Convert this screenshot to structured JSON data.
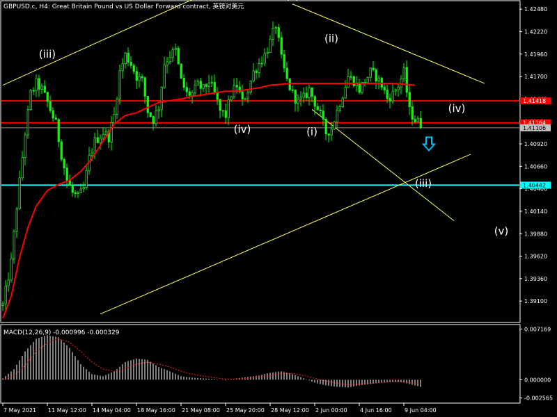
{
  "chart_title": "GBPUSD.c, H4:  Great Britain Pound vs US Dollar Forward contract, 英镑对美元",
  "macd_label": "MACD(12,26,9) -0.000996 -0.000329",
  "colors": {
    "background": "#000000",
    "candle": "#00ff00",
    "ma_line": "#ff0000",
    "trend_line": "#ffff66",
    "level_red": "#ff0000",
    "level_cyan": "#00ffff",
    "arrow": "#00bfff",
    "macd_hist": "#ffffff",
    "macd_signal": "#ff2020"
  },
  "chart_data": {
    "type": "candlestick",
    "symbol": "GBPUSD.c",
    "timeframe": "H4",
    "ylim": [
      1.3886,
      1.4257
    ],
    "y_ticks": [
      "1.42480",
      "1.42220",
      "1.41960",
      "1.41700",
      "1.41440",
      "1.41180",
      "1.40920",
      "1.40660",
      "1.40400",
      "1.40140",
      "1.39880",
      "1.39620",
      "1.39360",
      "1.39100"
    ],
    "x_ticks": [
      {
        "label": "7 May 2021",
        "bar": 0
      },
      {
        "label": "11 May 12:00",
        "bar": 16
      },
      {
        "label": "14 May 04:00",
        "bar": 32
      },
      {
        "label": "18 May 16:00",
        "bar": 48
      },
      {
        "label": "21 May 08:00",
        "bar": 64
      },
      {
        "label": "25 May 20:00",
        "bar": 80
      },
      {
        "label": "28 May 12:00",
        "bar": 96
      },
      {
        "label": "2 Jun 00:00",
        "bar": 112
      },
      {
        "label": "4 Jun 16:00",
        "bar": 128
      },
      {
        "label": "9 Jun 04:00",
        "bar": 144
      }
    ],
    "close_path": [
      [
        0,
        1.3905
      ],
      [
        3,
        1.3955
      ],
      [
        5,
        1.402
      ],
      [
        8,
        1.4105
      ],
      [
        10,
        1.415
      ],
      [
        12,
        1.4162
      ],
      [
        14,
        1.4155
      ],
      [
        16,
        1.414
      ],
      [
        19,
        1.4115
      ],
      [
        21,
        1.408
      ],
      [
        23,
        1.405
      ],
      [
        25,
        1.4035
      ],
      [
        27,
        1.403
      ],
      [
        29,
        1.404
      ],
      [
        31,
        1.4075
      ],
      [
        33,
        1.4095
      ],
      [
        36,
        1.4105
      ],
      [
        38,
        1.41
      ],
      [
        40,
        1.4125
      ],
      [
        42,
        1.4175
      ],
      [
        44,
        1.4195
      ],
      [
        46,
        1.4185
      ],
      [
        48,
        1.417
      ],
      [
        50,
        1.4165
      ],
      [
        52,
        1.413
      ],
      [
        54,
        1.412
      ],
      [
        56,
        1.4135
      ],
      [
        58,
        1.4185
      ],
      [
        60,
        1.4195
      ],
      [
        62,
        1.42
      ],
      [
        64,
        1.4165
      ],
      [
        66,
        1.415
      ],
      [
        68,
        1.415
      ],
      [
        70,
        1.416
      ],
      [
        72,
        1.4155
      ],
      [
        74,
        1.4165
      ],
      [
        76,
        1.415
      ],
      [
        78,
        1.413
      ],
      [
        80,
        1.4125
      ],
      [
        82,
        1.415
      ],
      [
        84,
        1.416
      ],
      [
        86,
        1.414
      ],
      [
        88,
        1.4155
      ],
      [
        90,
        1.4175
      ],
      [
        92,
        1.4185
      ],
      [
        94,
        1.4195
      ],
      [
        96,
        1.421
      ],
      [
        98,
        1.423
      ],
      [
        100,
        1.419
      ],
      [
        102,
        1.4165
      ],
      [
        104,
        1.415
      ],
      [
        106,
        1.414
      ],
      [
        108,
        1.4145
      ],
      [
        110,
        1.4155
      ],
      [
        112,
        1.414
      ],
      [
        114,
        1.4125
      ],
      [
        116,
        1.4105
      ],
      [
        118,
        1.411
      ],
      [
        120,
        1.413
      ],
      [
        122,
        1.415
      ],
      [
        124,
        1.417
      ],
      [
        126,
        1.4165
      ],
      [
        128,
        1.4155
      ],
      [
        130,
        1.4165
      ],
      [
        132,
        1.4175
      ],
      [
        134,
        1.417
      ],
      [
        136,
        1.416
      ],
      [
        138,
        1.4145
      ],
      [
        140,
        1.415
      ],
      [
        142,
        1.416
      ],
      [
        144,
        1.4175
      ],
      [
        146,
        1.413
      ],
      [
        148,
        1.412
      ],
      [
        150,
        1.4115
      ]
    ],
    "ma_path": [
      [
        0,
        1.389
      ],
      [
        3,
        1.3915
      ],
      [
        6,
        1.396
      ],
      [
        9,
        1.3995
      ],
      [
        12,
        1.402
      ],
      [
        16,
        1.4038
      ],
      [
        20,
        1.4045
      ],
      [
        24,
        1.405
      ],
      [
        28,
        1.406
      ],
      [
        32,
        1.4075
      ],
      [
        36,
        1.4095
      ],
      [
        40,
        1.4115
      ],
      [
        44,
        1.4125
      ],
      [
        48,
        1.4128
      ],
      [
        52,
        1.4134
      ],
      [
        56,
        1.414
      ],
      [
        60,
        1.4142
      ],
      [
        64,
        1.4144
      ],
      [
        68,
        1.4147
      ],
      [
        72,
        1.4149
      ],
      [
        76,
        1.4151
      ],
      [
        80,
        1.4153
      ],
      [
        84,
        1.4153
      ],
      [
        88,
        1.4155
      ],
      [
        92,
        1.4157
      ],
      [
        96,
        1.416
      ],
      [
        100,
        1.4161
      ],
      [
        104,
        1.4162
      ],
      [
        108,
        1.4162
      ],
      [
        112,
        1.4162
      ],
      [
        116,
        1.4162
      ],
      [
        120,
        1.4162
      ],
      [
        124,
        1.4162
      ],
      [
        128,
        1.4162
      ],
      [
        132,
        1.4162
      ],
      [
        136,
        1.4162
      ],
      [
        140,
        1.4162
      ],
      [
        144,
        1.4161
      ],
      [
        148,
        1.416
      ]
    ],
    "level_lines": [
      {
        "price": 1.41418,
        "label": "1.41418",
        "color": "#ff0000"
      },
      {
        "price": 1.41164,
        "label": "1.41164",
        "color": "#ff0000"
      },
      {
        "price": 1.41106,
        "label": "1.41106",
        "color": "#8c8c8c"
      },
      {
        "price": 1.40442,
        "label": "1.40442",
        "color": "#00ffff"
      }
    ],
    "trend_lines": [
      {
        "from": [
          0,
          1.416
        ],
        "to": [
          70,
          1.4262
        ]
      },
      {
        "from": [
          104,
          1.4254
        ],
        "to": [
          173,
          1.4162
        ]
      },
      {
        "from": [
          111,
          1.4132
        ],
        "to": [
          162,
          1.4003
        ]
      },
      {
        "from": [
          35,
          1.3895
        ],
        "to": [
          168,
          1.408
        ]
      }
    ],
    "wave_labels": [
      {
        "text": "(iii)",
        "bar": 16,
        "price": 1.4192
      },
      {
        "text": "(iv)",
        "bar": 86,
        "price": 1.4105
      },
      {
        "text": "(v)",
        "bar": 104,
        "price": 1.426
      },
      {
        "text": "(i)",
        "bar": 111,
        "price": 1.4102
      },
      {
        "text": "(ii)",
        "bar": 118,
        "price": 1.421
      },
      {
        "text": "(iii)",
        "bar": 151,
        "price": 1.4042
      },
      {
        "text": "(iv)",
        "bar": 163,
        "price": 1.4129
      },
      {
        "text": "(v)",
        "bar": 179,
        "price": 1.3987
      }
    ],
    "arrow": {
      "bar": 153,
      "price": 1.409
    },
    "macd": {
      "ylim": [
        -0.0032,
        0.0077
      ],
      "y_ticks": [
        "0.007169",
        "0.000000",
        "-0.002565"
      ],
      "hist_path": [
        [
          0,
          0.0002
        ],
        [
          4,
          0.0015
        ],
        [
          8,
          0.004
        ],
        [
          12,
          0.0058
        ],
        [
          16,
          0.0063
        ],
        [
          20,
          0.006
        ],
        [
          24,
          0.0045
        ],
        [
          28,
          0.0022
        ],
        [
          32,
          0.0008
        ],
        [
          36,
          0.0005
        ],
        [
          40,
          0.0012
        ],
        [
          44,
          0.0025
        ],
        [
          48,
          0.003
        ],
        [
          52,
          0.0028
        ],
        [
          56,
          0.0018
        ],
        [
          60,
          0.0012
        ],
        [
          64,
          0.0005
        ],
        [
          68,
          0.0003
        ],
        [
          72,
          0.0002
        ],
        [
          76,
          0.0001
        ],
        [
          80,
          -0.0001
        ],
        [
          84,
          0.0002
        ],
        [
          88,
          0.0004
        ],
        [
          92,
          0.0006
        ],
        [
          96,
          0.001
        ],
        [
          100,
          0.0012
        ],
        [
          104,
          0.0008
        ],
        [
          108,
          0.0002
        ],
        [
          112,
          -0.0004
        ],
        [
          116,
          -0.0008
        ],
        [
          120,
          -0.001
        ],
        [
          124,
          -0.0011
        ],
        [
          128,
          -0.0008
        ],
        [
          132,
          -0.0006
        ],
        [
          136,
          -0.0004
        ],
        [
          140,
          -0.0003
        ],
        [
          144,
          -0.0004
        ],
        [
          148,
          -0.0008
        ],
        [
          150,
          -0.001
        ]
      ],
      "signal_path": [
        [
          0,
          0.0
        ],
        [
          4,
          0.0006
        ],
        [
          8,
          0.002
        ],
        [
          12,
          0.004
        ],
        [
          16,
          0.0052
        ],
        [
          20,
          0.0058
        ],
        [
          24,
          0.0053
        ],
        [
          28,
          0.004
        ],
        [
          32,
          0.0025
        ],
        [
          36,
          0.0015
        ],
        [
          40,
          0.0012
        ],
        [
          44,
          0.0016
        ],
        [
          48,
          0.0022
        ],
        [
          52,
          0.0025
        ],
        [
          56,
          0.0022
        ],
        [
          60,
          0.0018
        ],
        [
          64,
          0.0012
        ],
        [
          68,
          0.0008
        ],
        [
          72,
          0.0005
        ],
        [
          76,
          0.0003
        ],
        [
          80,
          0.0001
        ],
        [
          84,
          0.0001
        ],
        [
          88,
          0.0002
        ],
        [
          92,
          0.0004
        ],
        [
          96,
          0.0006
        ],
        [
          100,
          0.0009
        ],
        [
          104,
          0.0009
        ],
        [
          108,
          0.0006
        ],
        [
          112,
          0.0002
        ],
        [
          116,
          -0.0002
        ],
        [
          120,
          -0.0005
        ],
        [
          124,
          -0.0007
        ],
        [
          128,
          -0.0006
        ],
        [
          132,
          -0.0005
        ],
        [
          136,
          -0.0004
        ],
        [
          140,
          -0.0003
        ],
        [
          144,
          -0.0003
        ],
        [
          148,
          -0.0005
        ],
        [
          150,
          -0.0006
        ]
      ]
    }
  }
}
